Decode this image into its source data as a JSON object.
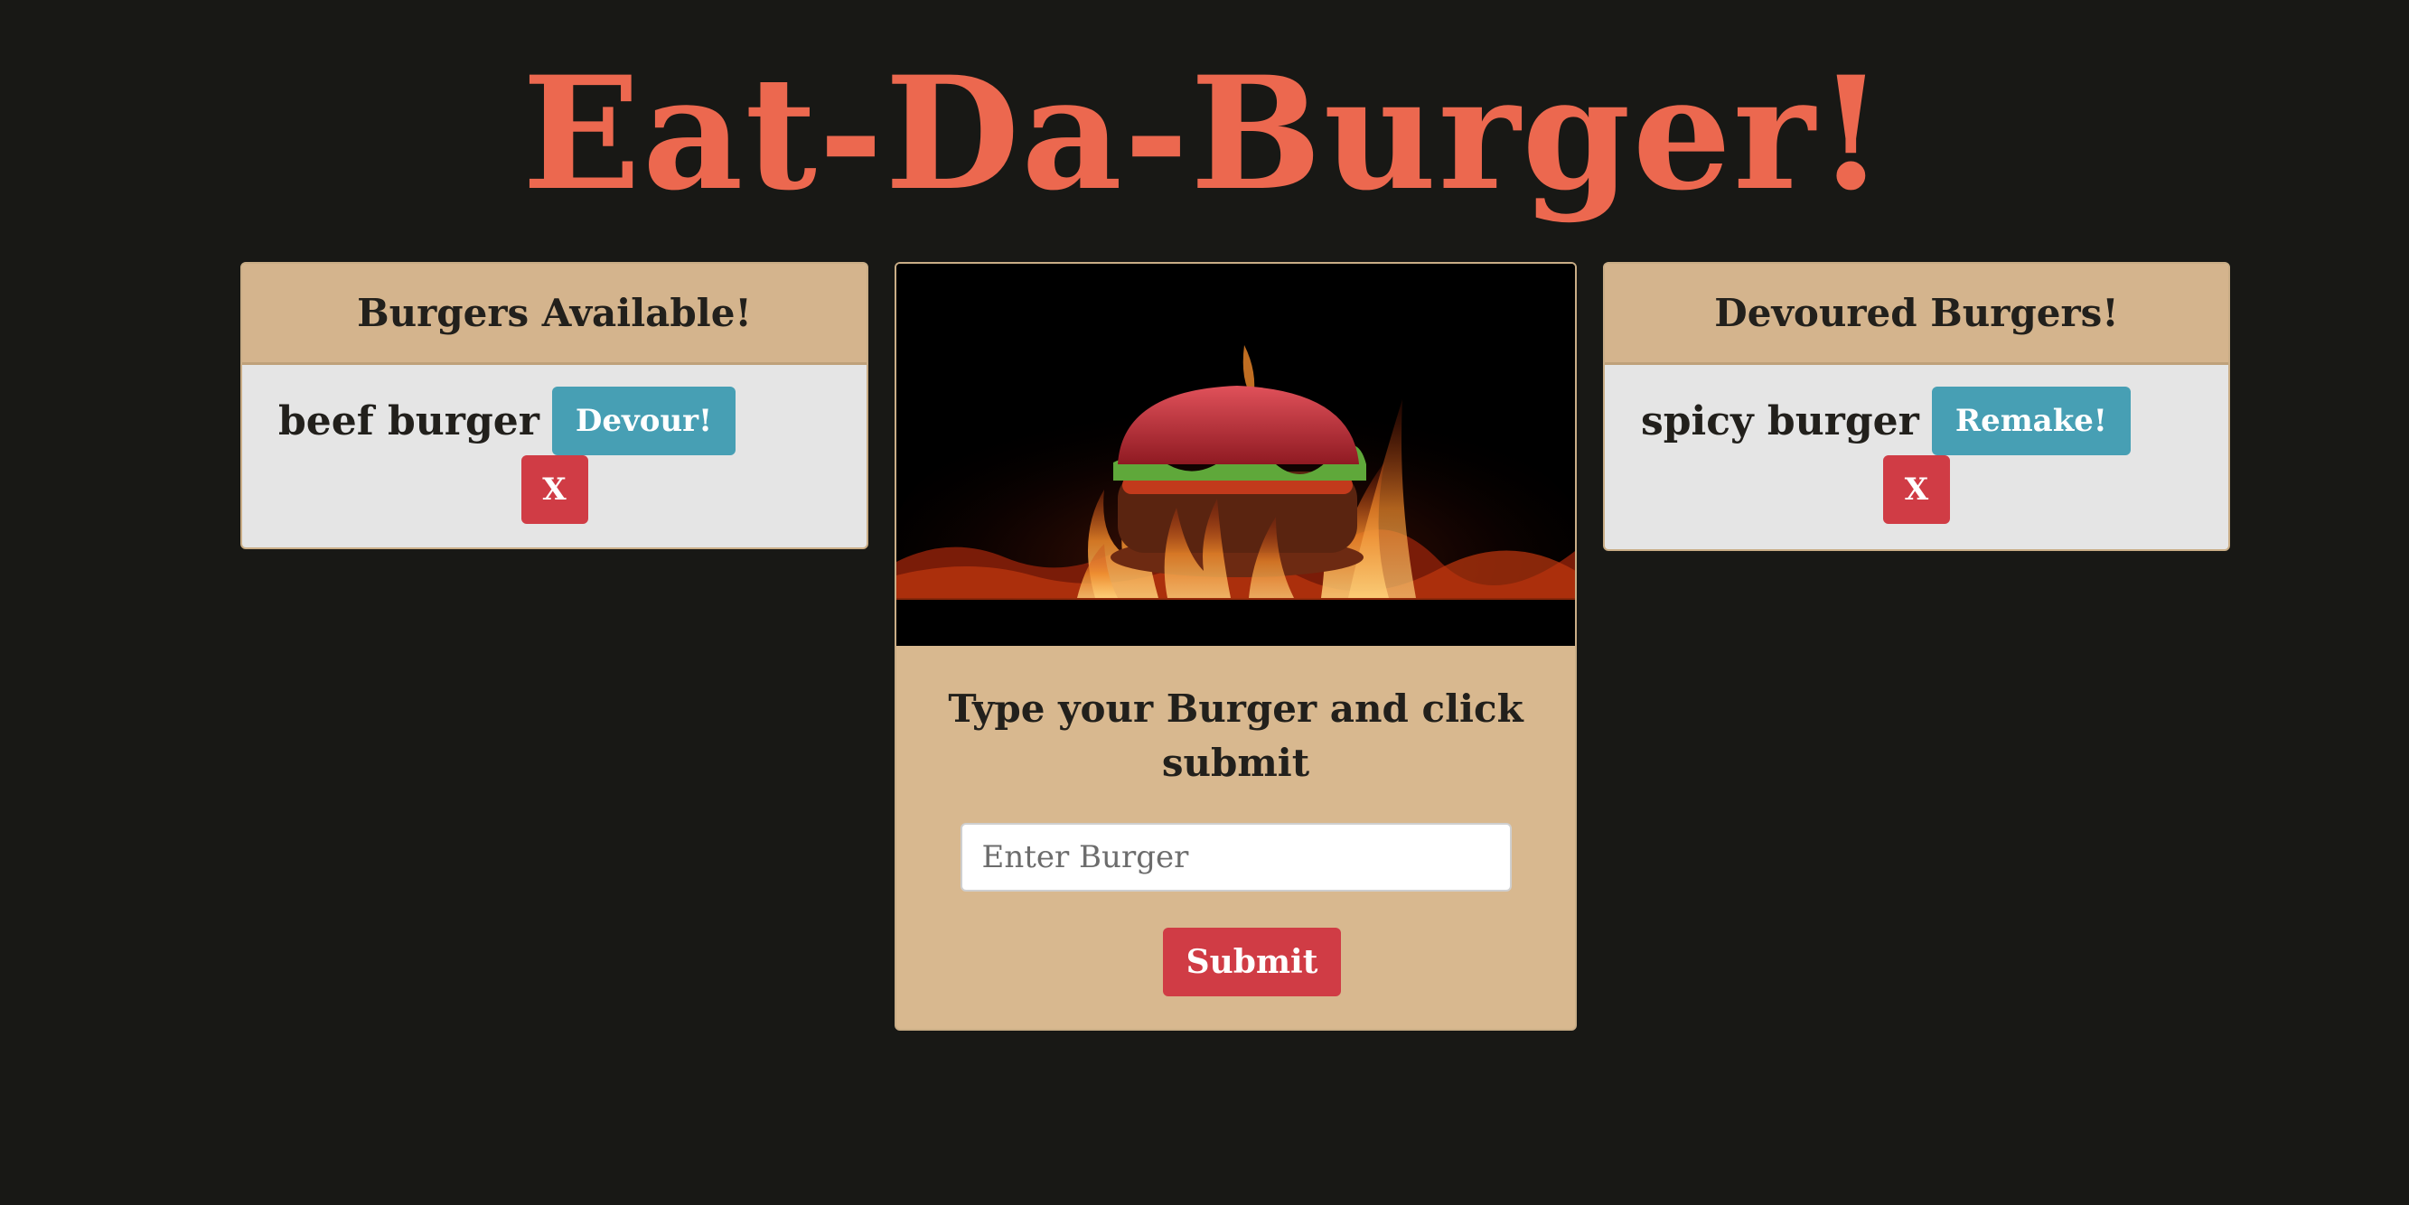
{
  "app": {
    "title": "Eat-Da-Burger!"
  },
  "available": {
    "header": "Burgers Available!",
    "items": [
      {
        "name": "beef burger",
        "action_label": "Devour!",
        "delete_label": "X"
      }
    ]
  },
  "devoured": {
    "header": "Devoured Burgers!",
    "items": [
      {
        "name": "spicy burger",
        "action_label": "Remake!",
        "delete_label": "X"
      }
    ]
  },
  "form": {
    "heading": "Type your Burger and click submit",
    "input_placeholder": "Enter Burger",
    "input_value": "",
    "submit_label": "Submit"
  },
  "colors": {
    "background": "#181815",
    "title": "#ec684f",
    "card_header": "#d4b48d",
    "card_body": "#e5e5e5",
    "form_panel": "#d8b88f",
    "info_button": "#479fb4",
    "danger_button": "#d03c45"
  }
}
